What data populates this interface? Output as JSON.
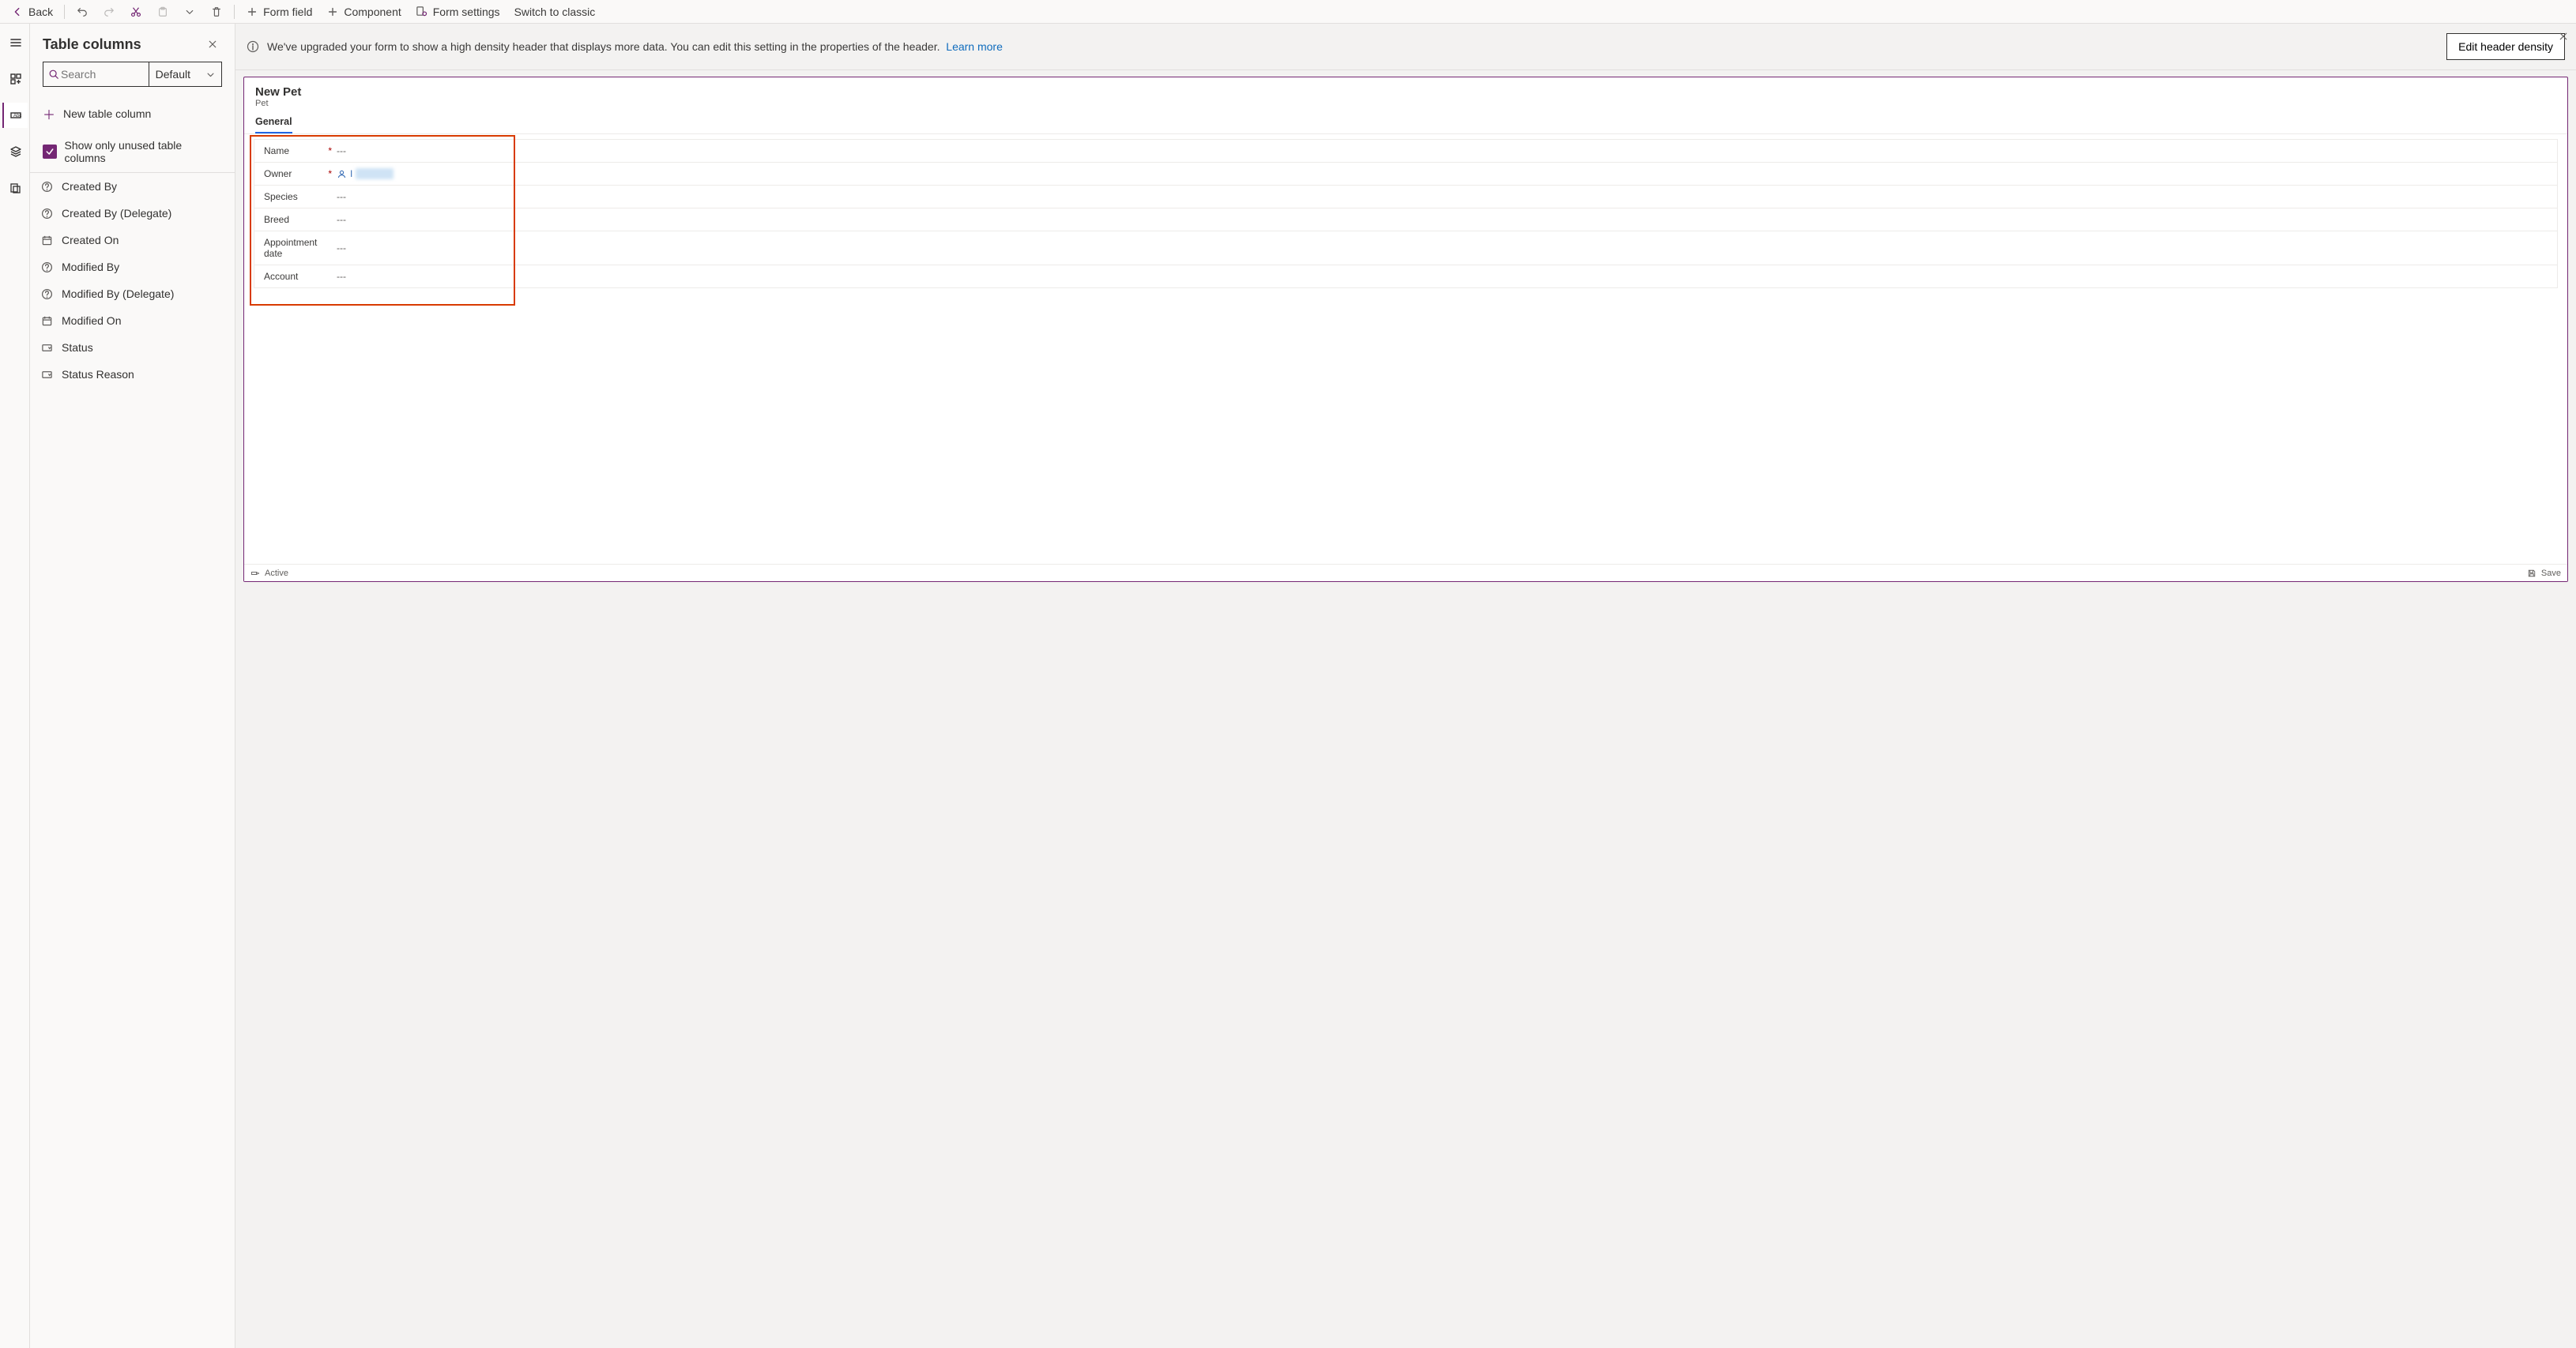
{
  "topbar": {
    "back": "Back",
    "form_field": "Form field",
    "component": "Component",
    "form_settings": "Form settings",
    "switch_classic": "Switch to classic"
  },
  "panel": {
    "title": "Table columns",
    "search_placeholder": "Search",
    "filter_value": "Default",
    "new_column": "New table column",
    "show_unused": "Show only unused table columns",
    "columns": [
      {
        "label": "Created By",
        "icon": "question"
      },
      {
        "label": "Created By (Delegate)",
        "icon": "question"
      },
      {
        "label": "Created On",
        "icon": "calendar"
      },
      {
        "label": "Modified By",
        "icon": "question"
      },
      {
        "label": "Modified By (Delegate)",
        "icon": "question"
      },
      {
        "label": "Modified On",
        "icon": "calendar"
      },
      {
        "label": "Status",
        "icon": "dropdown"
      },
      {
        "label": "Status Reason",
        "icon": "dropdown"
      }
    ]
  },
  "notice": {
    "text": "We've upgraded your form to show a high density header that displays more data. You can edit this setting in the properties of the header.",
    "link": "Learn more",
    "button": "Edit header density"
  },
  "form": {
    "title": "New Pet",
    "subtitle": "Pet",
    "tab": "General",
    "fields": [
      {
        "label": "Name",
        "required": true,
        "value": "---",
        "type": "text"
      },
      {
        "label": "Owner",
        "required": true,
        "value": "I",
        "type": "person"
      },
      {
        "label": "Species",
        "required": false,
        "value": "---",
        "type": "text"
      },
      {
        "label": "Breed",
        "required": false,
        "value": "---",
        "type": "text"
      },
      {
        "label": "Appointment date",
        "required": false,
        "value": "---",
        "type": "text"
      },
      {
        "label": "Account",
        "required": false,
        "value": "---",
        "type": "text"
      }
    ],
    "status": "Active",
    "save": "Save"
  }
}
